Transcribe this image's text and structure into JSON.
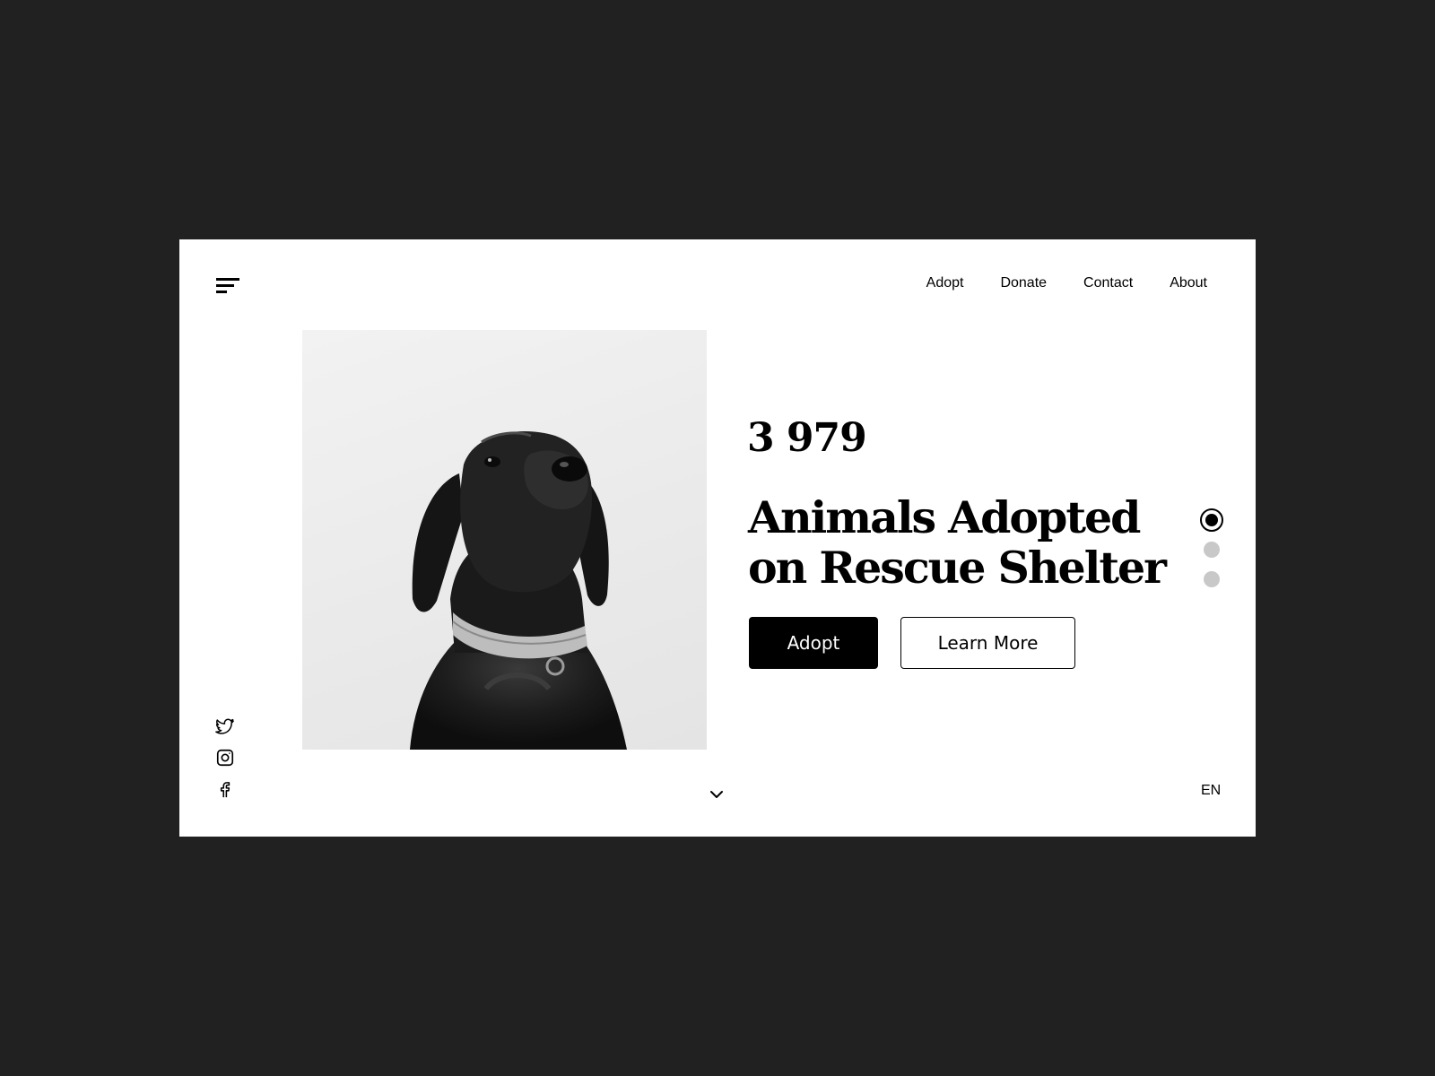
{
  "nav": {
    "menu_icon": "hamburger-menu-icon",
    "items": [
      {
        "label": "Adopt"
      },
      {
        "label": "Donate"
      },
      {
        "label": "Contact"
      },
      {
        "label": "About"
      }
    ]
  },
  "hero": {
    "stat": "3 979",
    "headline_line1": "Animals Adopted",
    "headline_line2": "on Rescue Shelter",
    "primary_button": "Adopt",
    "secondary_button": "Learn More",
    "image": "dog-portrait-black-and-white"
  },
  "slider": {
    "count": 3,
    "active_index": 0
  },
  "social": [
    "twitter-icon",
    "instagram-icon",
    "facebook-icon"
  ],
  "footer": {
    "scroll_icon": "chevron-down-icon",
    "language": "EN"
  },
  "colors": {
    "background": "#212121",
    "page": "#ffffff",
    "primary": "#000000",
    "inactive_dot": "#c8c8c8"
  }
}
